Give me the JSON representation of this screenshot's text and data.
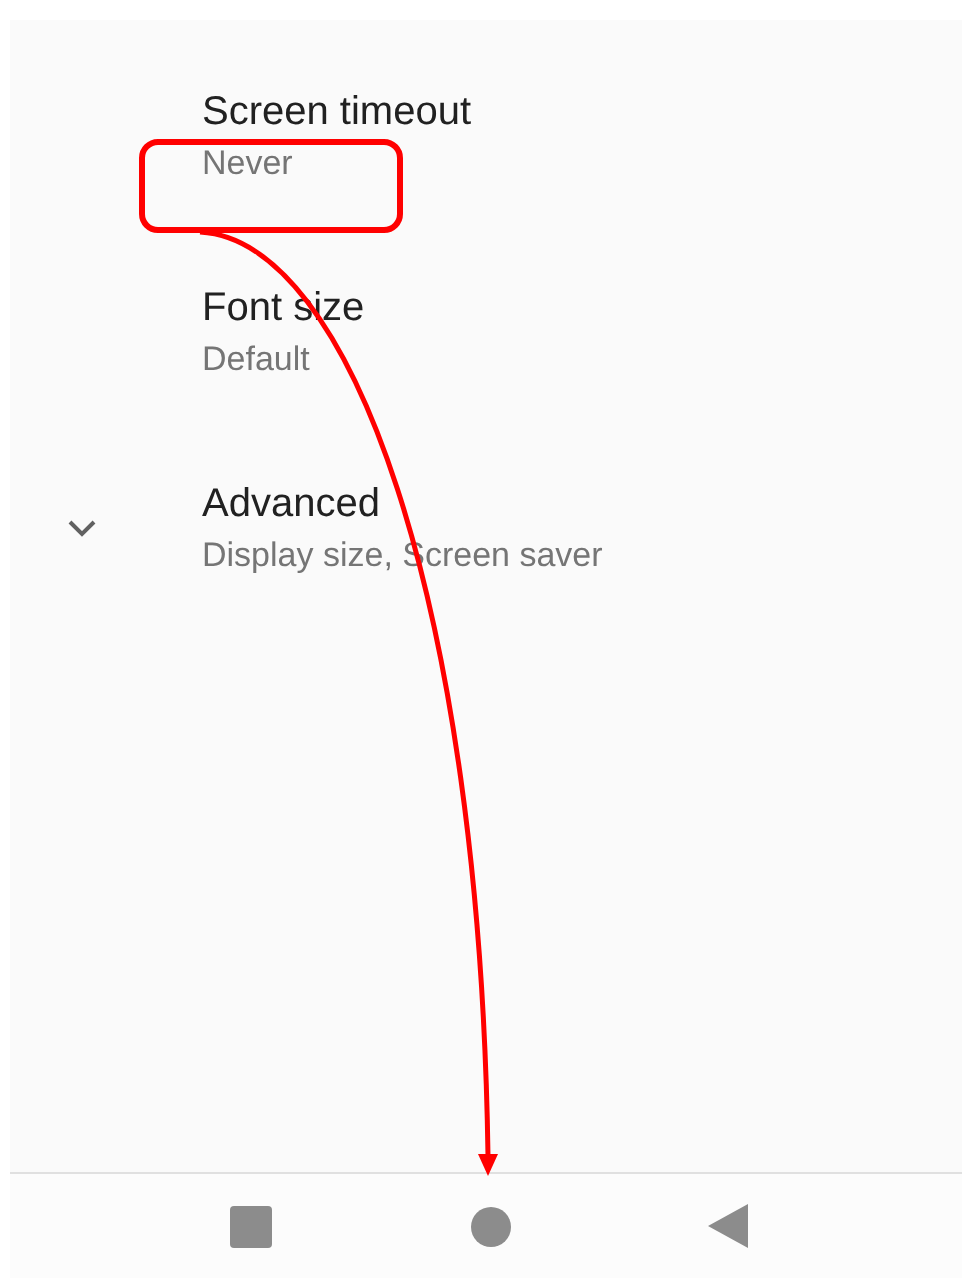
{
  "settings": [
    {
      "kind": "plain",
      "title": "Screen timeout",
      "summary": "Never"
    },
    {
      "kind": "plain",
      "title": "Font size",
      "summary": "Default"
    },
    {
      "kind": "expandable",
      "expanded": false,
      "title": "Advanced",
      "summary": "Display size, Screen saver"
    }
  ],
  "nav_bar": [
    {
      "kind": "recents"
    },
    {
      "kind": "home"
    },
    {
      "kind": "back"
    }
  ]
}
